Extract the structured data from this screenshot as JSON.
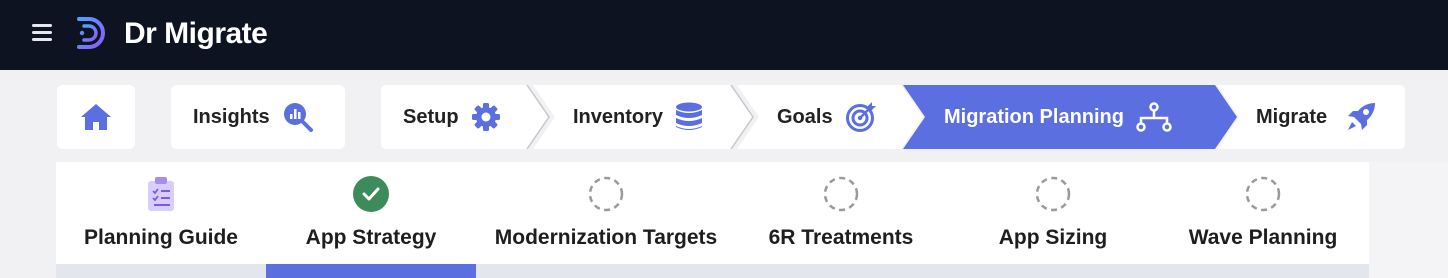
{
  "app": {
    "brand": "Dr Migrate",
    "menu_icon": "hamburger-menu-icon",
    "logo_icon": "dr-migrate-logo-icon"
  },
  "nav": {
    "home": {
      "icon": "home-icon"
    },
    "insights": {
      "label": "Insights",
      "icon": "chart-search-icon"
    },
    "steps": [
      {
        "label": "Setup",
        "icon": "gear-icon",
        "active": false
      },
      {
        "label": "Inventory",
        "icon": "database-icon",
        "active": false
      },
      {
        "label": "Goals",
        "icon": "target-icon",
        "active": false
      },
      {
        "label": "Migration Planning",
        "icon": "sitemap-icon",
        "active": true
      },
      {
        "label": "Migrate",
        "icon": "rocket-icon",
        "active": false
      }
    ]
  },
  "tabs": [
    {
      "label": "Planning Guide",
      "status": "guide",
      "icon": "clipboard-checklist-icon"
    },
    {
      "label": "App Strategy",
      "status": "complete",
      "selected": true,
      "icon": "check-circle-icon"
    },
    {
      "label": "Modernization Targets",
      "status": "pending",
      "icon": "dashed-circle-icon"
    },
    {
      "label": "6R Treatments",
      "status": "pending",
      "icon": "dashed-circle-icon"
    },
    {
      "label": "App Sizing",
      "status": "pending",
      "icon": "dashed-circle-icon"
    },
    {
      "label": "Wave Planning",
      "status": "pending",
      "icon": "dashed-circle-icon"
    }
  ],
  "colors": {
    "topbar": "#0d1321",
    "accent": "#5b6fe0",
    "complete": "#3d8a5a",
    "pending": "#9a9a9a",
    "icon_blue": "#5b6fe0"
  }
}
